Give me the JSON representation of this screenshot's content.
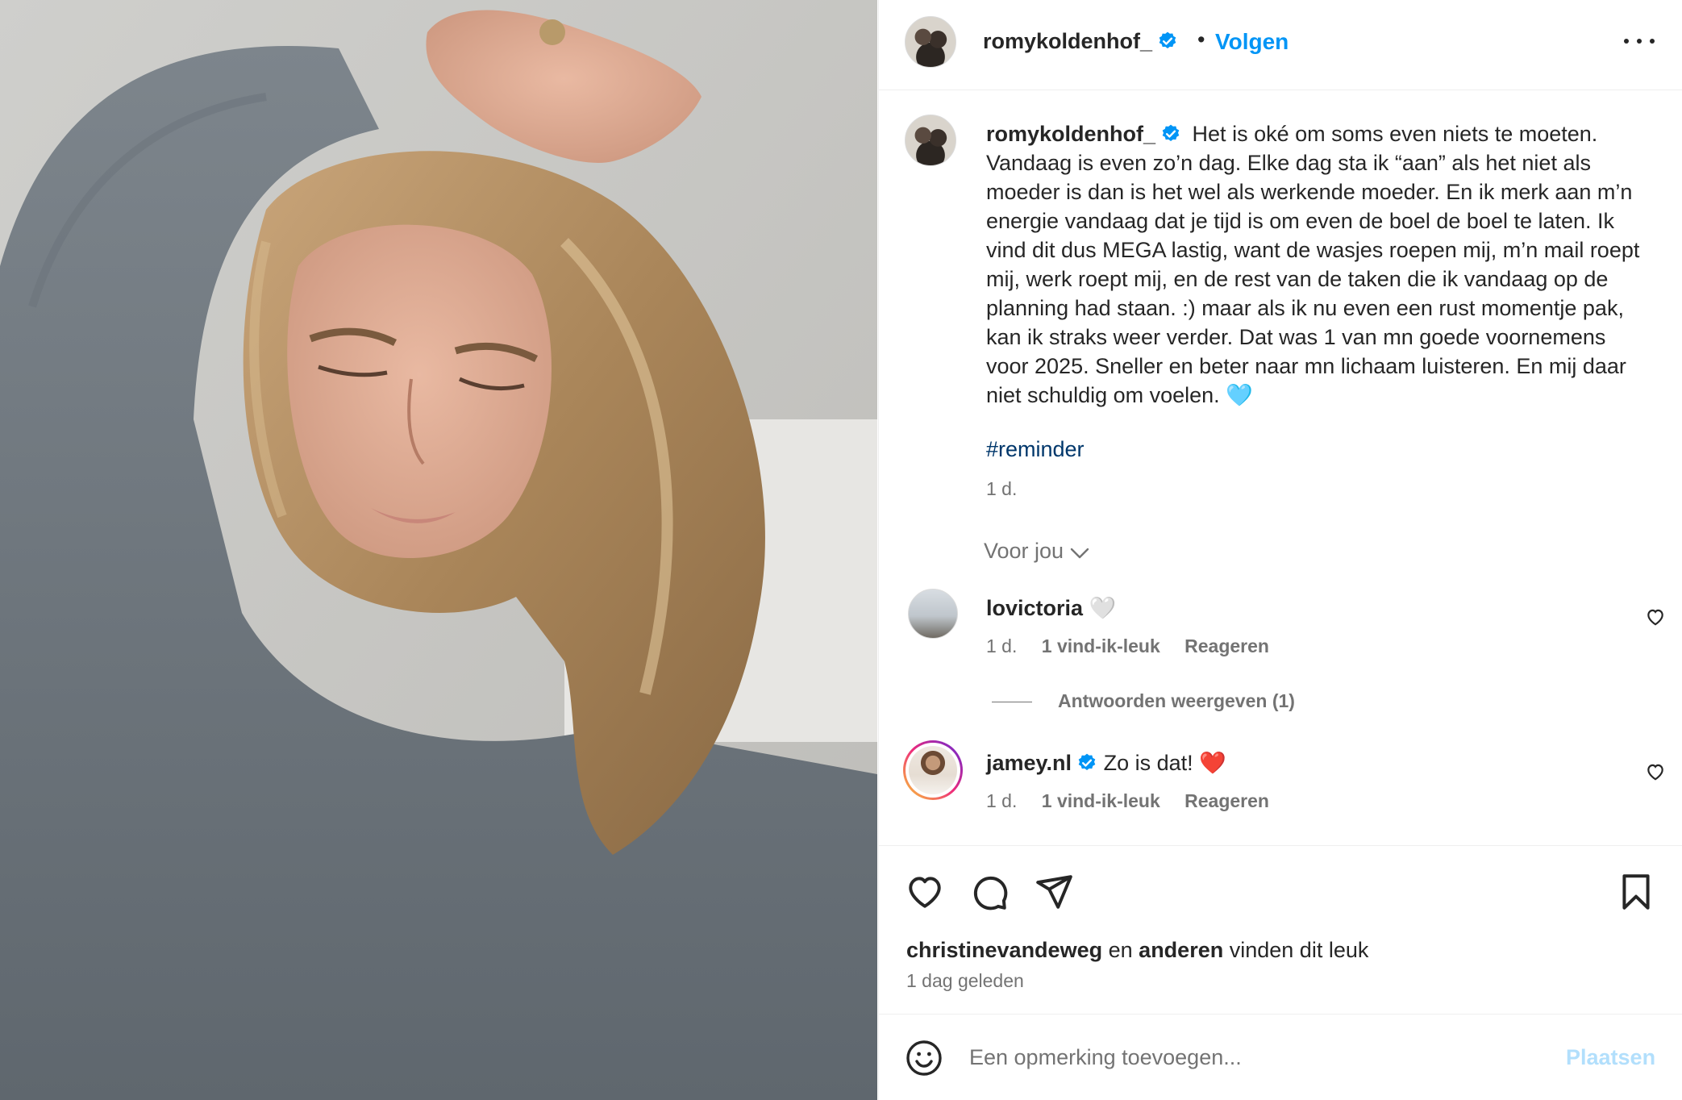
{
  "post": {
    "author": "romykoldenhof_",
    "follow_label": "Volgen",
    "separator": "•",
    "caption": "Het is oké om soms even niets te moeten. Vandaag is even zo’n dag. Elke dag sta ik “aan” als het niet als moeder is dan is het wel als werkende moeder. En ik merk aan m’n energie vandaag dat je tijd is om even de boel de boel te laten. Ik vind dit dus MEGA lastig, want de wasjes roepen mij, m’n mail roept mij, werk roept mij, en de rest van de taken die ik vandaag op de planning had staan. :) maar als ik nu even een rust momentje pak, kan ik straks weer verder. Dat was 1 van mn goede voornemens voor 2025. Sneller en beter naar mn lichaam luisteren. En mij daar niet schuldig om voelen. 🩵",
    "hashtag": "#reminder",
    "caption_time": "1 d."
  },
  "comments_section": {
    "sort_label": "Voor jou",
    "comments": [
      {
        "username": "lovictoria",
        "text": "🤍",
        "time": "1 d.",
        "likes": "1 vind-ik-leuk",
        "reply_label": "Reageren",
        "replies_label": "Antwoorden weergeven (1)"
      },
      {
        "username": "jamey.nl",
        "text": "Zo is dat! ❤️",
        "time": "1 d.",
        "likes": "1 vind-ik-leuk",
        "reply_label": "Reageren"
      }
    ]
  },
  "actions": {
    "liked_by_user": "christinevandeweg",
    "liked_by_conjunction": "en",
    "liked_by_others": "anderen",
    "liked_by_suffix": "vinden dit leuk",
    "post_time": "1 dag geleden"
  },
  "comment_bar": {
    "placeholder": "Een opmerking toevoegen...",
    "post_label": "Plaatsen"
  },
  "colors": {
    "accent": "#0095f6",
    "verified": "#0095f6",
    "hashtag": "#00376b",
    "secondary_text": "#737373",
    "post_disabled": "#b2dffc"
  }
}
